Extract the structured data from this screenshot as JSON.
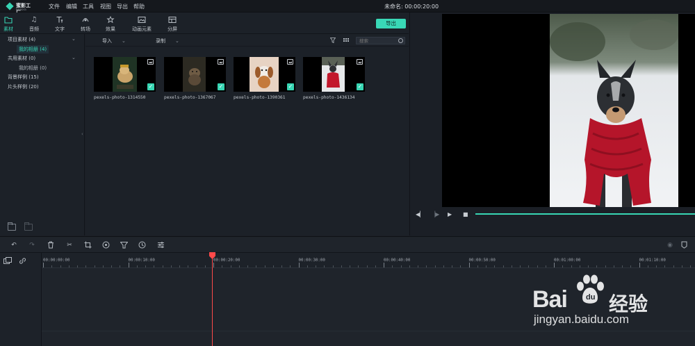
{
  "app": {
    "logo_text": "蜜影工厂",
    "logo_sub": "Filmora",
    "menu": [
      "文件",
      "编辑",
      "工具",
      "视图",
      "导出",
      "帮助"
    ],
    "project_title": "未命名: 00:00:20:00"
  },
  "toolbar": {
    "tabs": [
      {
        "label": "素材",
        "icon": "folder-icon",
        "active": true
      },
      {
        "label": "音频",
        "icon": "music-note-icon",
        "active": false
      },
      {
        "label": "文字",
        "icon": "text-icon",
        "active": false
      },
      {
        "label": "转场",
        "icon": "transition-icon",
        "active": false
      },
      {
        "label": "效果",
        "icon": "effects-icon",
        "active": false
      },
      {
        "label": "动画元素",
        "icon": "elements-icon",
        "active": false
      },
      {
        "label": "分屏",
        "icon": "split-screen-icon",
        "active": false
      }
    ],
    "export_label": "导出"
  },
  "sidebar": {
    "items": [
      {
        "label": "项目素材 (4)",
        "expandable": true
      },
      {
        "label": "我的相册 (4)",
        "active": true
      },
      {
        "label": "共用素材 (0)",
        "expandable": true
      },
      {
        "label": "我的相册 (0)"
      },
      {
        "label": "背景样例 (15)"
      },
      {
        "label": "片头样例 (20)"
      }
    ]
  },
  "media": {
    "import_label": "导入",
    "record_label": "录制",
    "search_placeholder": "搜索",
    "items": [
      {
        "name": "pexels-photo-1314550",
        "selected": true
      },
      {
        "name": "pexels-photo-1367067",
        "selected": true
      },
      {
        "name": "pexels-photo-1390361",
        "selected": true
      },
      {
        "name": "pexels-photo-1436134",
        "selected": true
      }
    ]
  },
  "preview": {
    "progress": 1.0
  },
  "timeline": {
    "ticks": [
      "00:00:00:00",
      "00:00:10:00",
      "00:00:20:00",
      "00:00:30:00",
      "00:00:40:00",
      "00:00:50:00",
      "00:01:00:00",
      "00:01:10:00"
    ],
    "playhead_time": "00:00:20:00"
  },
  "watermark": {
    "brand": "Bai",
    "brand_cn": "经验",
    "url": "jingyan.baidu.com"
  },
  "colors": {
    "accent": "#38d6b4",
    "playhead": "#ff4a4a",
    "background": "#1b1f26"
  }
}
